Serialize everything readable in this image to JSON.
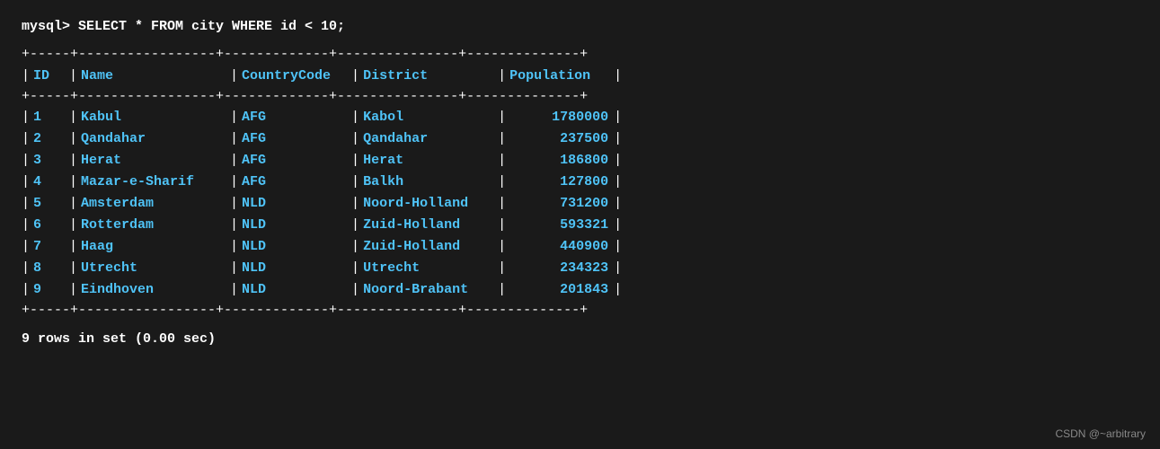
{
  "query": "mysql> SELECT * FROM city WHERE id < 10;",
  "divider": "+-----+-----------------+-------------+---------------+--------------+",
  "headers": {
    "id": "ID",
    "name": "Name",
    "countrycode": "CountryCode",
    "district": "District",
    "population": "Population"
  },
  "rows": [
    {
      "id": "1",
      "name": "Kabul",
      "cc": "AFG",
      "district": "Kabol",
      "population": "1780000"
    },
    {
      "id": "2",
      "name": "Qandahar",
      "cc": "AFG",
      "district": "Qandahar",
      "population": "237500"
    },
    {
      "id": "3",
      "name": "Herat",
      "cc": "AFG",
      "district": "Herat",
      "population": "186800"
    },
    {
      "id": "4",
      "name": "Mazar-e-Sharif",
      "cc": "AFG",
      "district": "Balkh",
      "population": "127800"
    },
    {
      "id": "5",
      "name": "Amsterdam",
      "cc": "NLD",
      "district": "Noord-Holland",
      "population": "731200"
    },
    {
      "id": "6",
      "name": "Rotterdam",
      "cc": "NLD",
      "district": "Zuid-Holland",
      "population": "593321"
    },
    {
      "id": "7",
      "name": "Haag",
      "cc": "NLD",
      "district": "Zuid-Holland",
      "population": "440900"
    },
    {
      "id": "8",
      "name": "Utrecht",
      "cc": "NLD",
      "district": "Utrecht",
      "population": "234323"
    },
    {
      "id": "9",
      "name": "Eindhoven",
      "cc": "NLD",
      "district": "Noord-Brabant",
      "population": "201843"
    }
  ],
  "footer": "9 rows in set (0.00 sec)",
  "watermark": "CSDN @~arbitrary"
}
